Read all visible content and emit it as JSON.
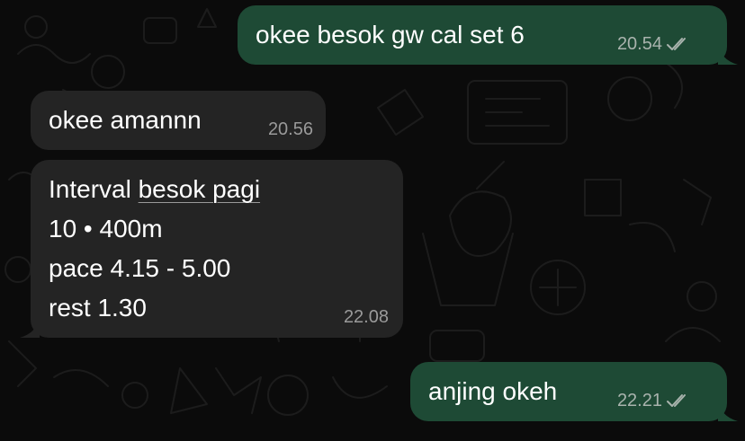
{
  "messages": [
    {
      "direction": "outgoing",
      "text": "okee besok gw cal set 6",
      "time": "20.54",
      "status": "read"
    },
    {
      "direction": "incoming",
      "text": "okee amannn",
      "time": "20.56"
    },
    {
      "direction": "incoming",
      "lines": {
        "l1_prefix": "Interval ",
        "l1_link": "besok pagi",
        "l2": "10 • 400m",
        "l3": "pace 4.15 - 5.00",
        "l4": "rest 1.30"
      },
      "time": "22.08"
    },
    {
      "direction": "outgoing",
      "text": "anjing okeh",
      "time": "22.21",
      "status": "read"
    }
  ],
  "icons": {
    "status": "double-check-icon",
    "wallpaper": "doodle-pattern"
  },
  "colors": {
    "background": "#0b0b0b",
    "outgoing_bubble": "#1e4a35",
    "incoming_bubble": "#242424",
    "text": "#ffffff",
    "meta_text": "#a9b3ad"
  }
}
